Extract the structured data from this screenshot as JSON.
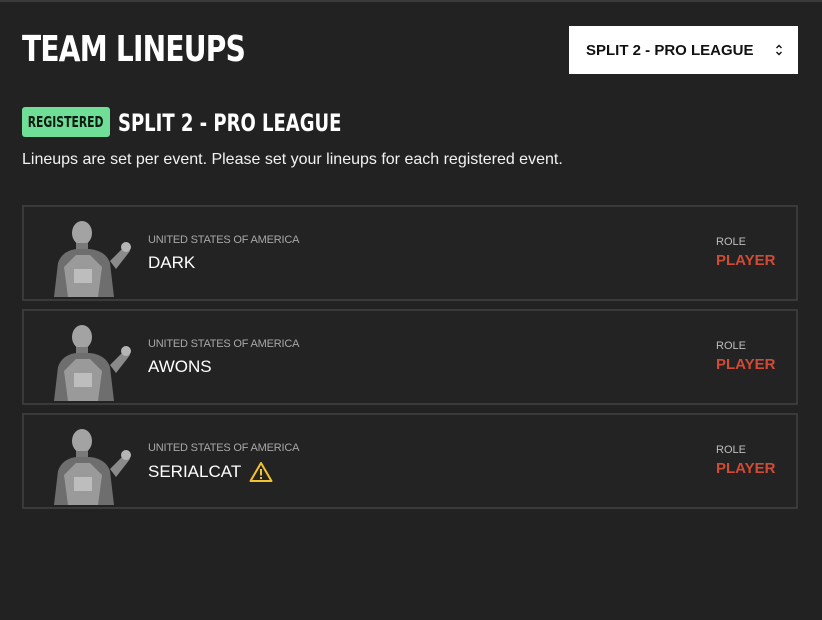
{
  "header": {
    "title": "TEAM LINEUPS",
    "event_select": {
      "selected": "SPLIT 2 - PRO LEAGUE",
      "icon": "chevron-up-down-icon"
    }
  },
  "event": {
    "status_badge": "REGISTERED",
    "name": "SPLIT 2 - PRO LEAGUE",
    "description": "Lineups are set per event. Please set your lineups for each registered event."
  },
  "players": [
    {
      "country": "UNITED STATES OF AMERICA",
      "name": "DARK",
      "role_label": "ROLE",
      "role": "PLAYER",
      "warning": false
    },
    {
      "country": "UNITED STATES OF AMERICA",
      "name": "AWONS",
      "role_label": "ROLE",
      "role": "PLAYER",
      "warning": false
    },
    {
      "country": "UNITED STATES OF AMERICA",
      "name": "SERIALCAT",
      "role_label": "ROLE",
      "role": "PLAYER",
      "warning": true
    }
  ],
  "colors": {
    "background": "#222222",
    "badge": "#6fde97",
    "role": "#d14a36",
    "warning": "#f2c230",
    "card_border": "#3a3a3a"
  }
}
